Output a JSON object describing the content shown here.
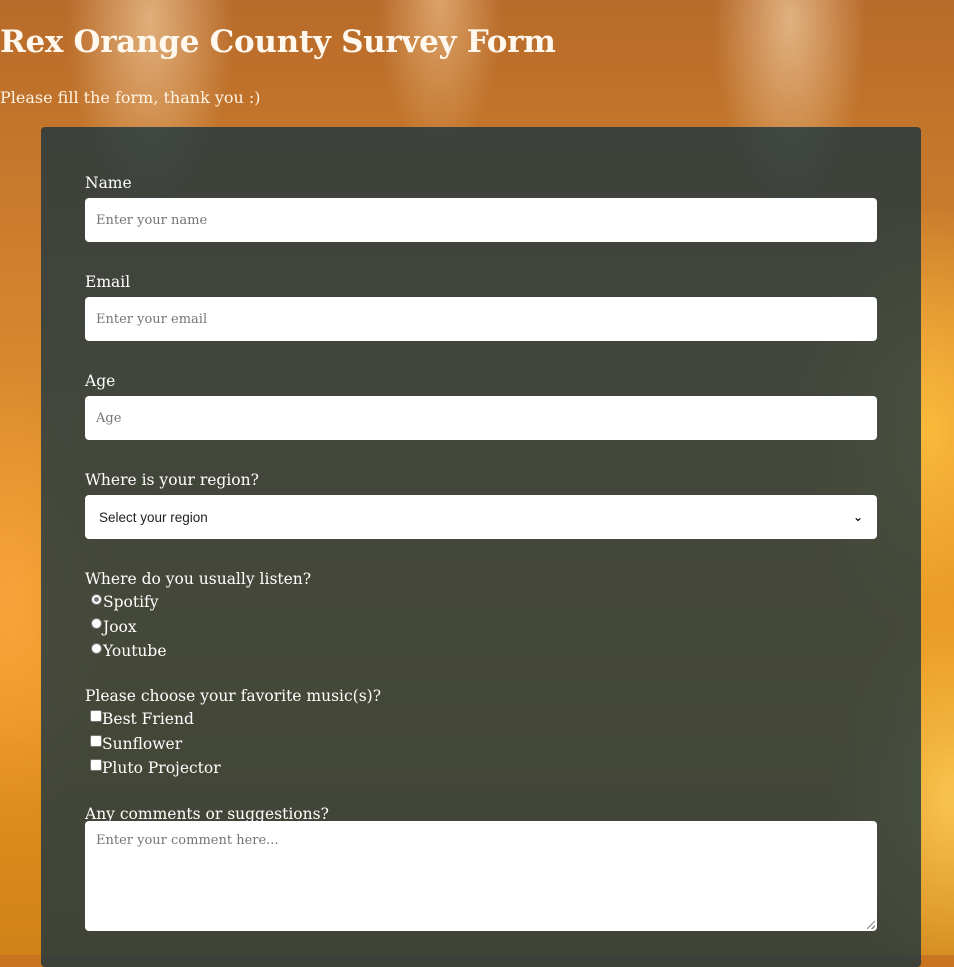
{
  "header": {
    "title": "Rex Orange County Survey Form",
    "subtitle": "Please fill the form, thank you :)"
  },
  "form": {
    "name": {
      "label": "Name",
      "placeholder": "Enter your name"
    },
    "email": {
      "label": "Email",
      "placeholder": "Enter your email"
    },
    "age": {
      "label": "Age",
      "placeholder": "Age"
    },
    "region": {
      "label": "Where is your region?",
      "selected": "Select your region"
    },
    "listen": {
      "label": "Where do you usually listen?",
      "options": [
        "Spotify",
        "Joox",
        "Youtube"
      ]
    },
    "music": {
      "label": "Please choose your favorite music(s)?",
      "options": [
        "Best Friend",
        "Sunflower",
        "Pluto Projector"
      ]
    },
    "comments": {
      "label": "Any comments or suggestions?",
      "placeholder": "Enter your comment here..."
    }
  }
}
